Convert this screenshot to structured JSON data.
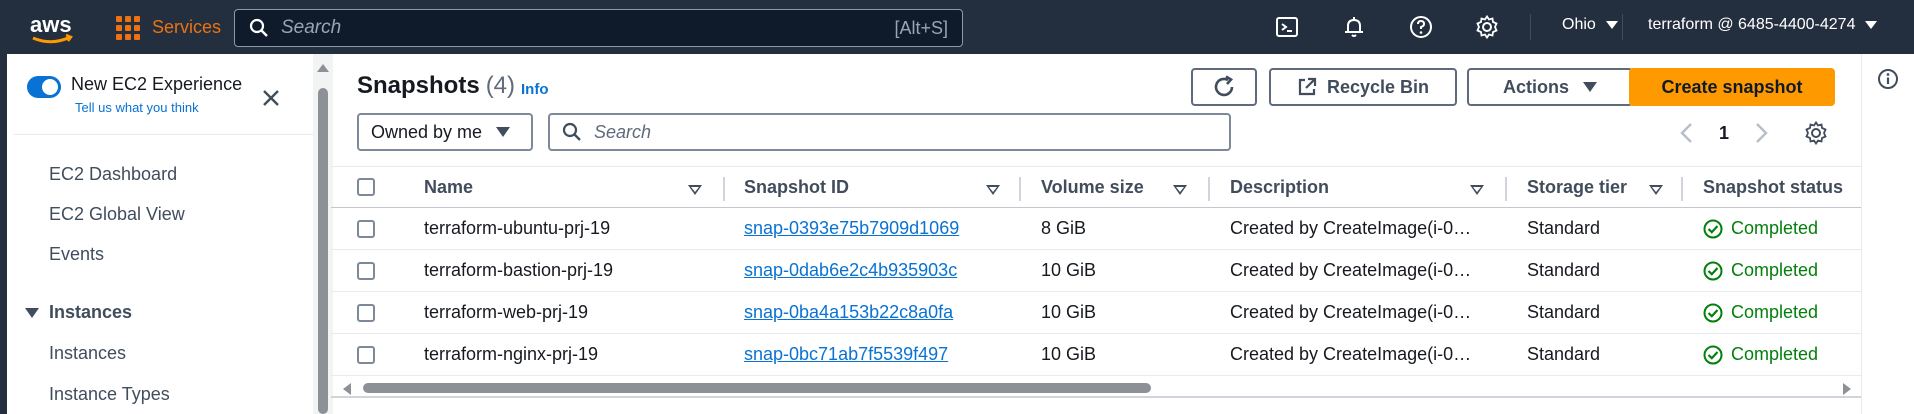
{
  "topbar": {
    "logo": "aws",
    "services_label": "Services",
    "search_placeholder": "Search",
    "search_shortcut": "[Alt+S]",
    "region": "Ohio",
    "account": "terraform @ 6485-4400-4274",
    "icons": [
      "cloudshell-icon",
      "bell-icon",
      "help-icon",
      "gear-icon"
    ],
    "background": "#232f3e",
    "accent": "#ec7211"
  },
  "sidebar": {
    "new_experience_label": "New EC2 Experience",
    "new_experience_on": true,
    "tell_us": "Tell us what you think",
    "items": [
      {
        "label": "EC2 Dashboard"
      },
      {
        "label": "EC2 Global View"
      },
      {
        "label": "Events"
      }
    ],
    "section": {
      "label": "Instances",
      "expanded": true
    },
    "section_items": [
      {
        "label": "Instances"
      },
      {
        "label": "Instance Types"
      }
    ]
  },
  "header": {
    "title": "Snapshots",
    "count": "(4)",
    "info": "Info",
    "refresh_icon": "refresh-icon",
    "recycle_bin": "Recycle Bin",
    "actions": "Actions",
    "create": "Create snapshot"
  },
  "filters": {
    "owner_selected": "Owned by me",
    "search_placeholder": "Search",
    "page": "1"
  },
  "table": {
    "columns": [
      "Name",
      "Snapshot ID",
      "Volume size",
      "Description",
      "Storage tier",
      "Snapshot status"
    ],
    "rows": [
      {
        "name": "terraform-ubuntu-prj-19",
        "id": "snap-0393e75b7909d1069",
        "size": "8 GiB",
        "desc": "Created by CreateImage(i-0…",
        "tier": "Standard",
        "status": "Completed"
      },
      {
        "name": "terraform-bastion-prj-19",
        "id": "snap-0dab6e2c4b935903c",
        "size": "10 GiB",
        "desc": "Created by CreateImage(i-0…",
        "tier": "Standard",
        "status": "Completed"
      },
      {
        "name": "terraform-web-prj-19",
        "id": "snap-0ba4a153b22c8a0fa",
        "size": "10 GiB",
        "desc": "Created by CreateImage(i-0…",
        "tier": "Standard",
        "status": "Completed"
      },
      {
        "name": "terraform-nginx-prj-19",
        "id": "snap-0bc71ab7f5539f497",
        "size": "10 GiB",
        "desc": "Created by CreateImage(i-0…",
        "tier": "Standard",
        "status": "Completed"
      }
    ],
    "status_color": "#037f0c",
    "link_color": "#0972d3"
  }
}
